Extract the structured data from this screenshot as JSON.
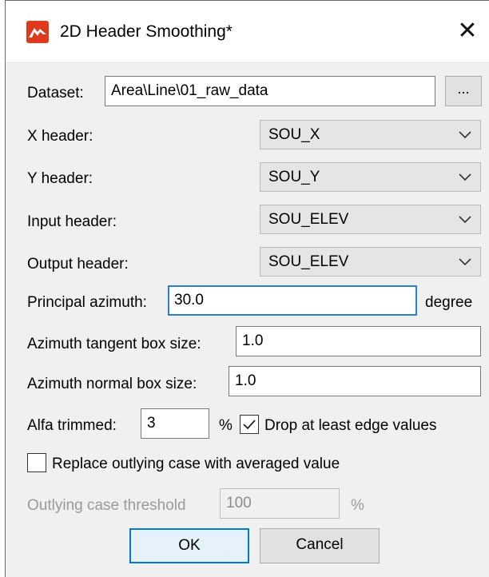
{
  "window": {
    "title": "2D Header Smoothing*"
  },
  "dataset": {
    "label": "Dataset:",
    "value": "Area\\Line\\01_raw_data",
    "browse": "..."
  },
  "headers": [
    {
      "label": "X header:",
      "value": "SOU_X"
    },
    {
      "label": "Y header:",
      "value": "SOU_Y"
    },
    {
      "label": "Input header:",
      "value": "SOU_ELEV"
    },
    {
      "label": "Output header:",
      "value": "SOU_ELEV"
    }
  ],
  "principal_azimuth": {
    "label": "Principal azimuth:",
    "value": "30.0",
    "unit": "degree"
  },
  "tangent_box": {
    "label": "Azimuth tangent box size:",
    "value": "1.0"
  },
  "normal_box": {
    "label": "Azimuth normal box size:",
    "value": "1.0"
  },
  "alfa": {
    "label": "Alfa trimmed:",
    "value": "3",
    "unit": "%"
  },
  "drop_edge": {
    "label": "Drop at least edge values",
    "checked": true
  },
  "replace_outlying": {
    "label": "Replace outlying case with averaged value",
    "checked": false
  },
  "outlying_threshold": {
    "label": "Outlying case threshold",
    "value": "100",
    "unit": "%"
  },
  "buttons": {
    "ok": "OK",
    "cancel": "Cancel"
  },
  "colors": {
    "accent": "#0078d7",
    "focus": "#2d7fd0",
    "app_icon": "#e03a1e"
  }
}
